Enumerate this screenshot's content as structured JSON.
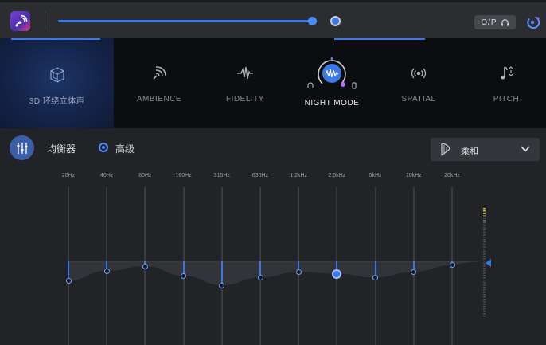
{
  "topbar": {
    "app_icon": "speaker-wave-logo",
    "volume_percent": 100,
    "output_button_label": "O/P",
    "output_icon": "headphones-icon",
    "power_icon": "power-icon"
  },
  "effects": {
    "tabs": [
      {
        "id": "3d",
        "label": "3D 环绕立体声",
        "icon": "cube-icon",
        "selected": true
      },
      {
        "id": "ambience",
        "label": "AMBIENCE",
        "icon": "ambience-icon"
      },
      {
        "id": "fidelity",
        "label": "FIDELITY",
        "icon": "waveform-icon"
      },
      {
        "id": "night",
        "label": "NIGHT MODE",
        "icon": "night-mode-dial-icon",
        "active": true
      },
      {
        "id": "spatial",
        "label": "SPATIAL",
        "icon": "spatial-icon"
      },
      {
        "id": "pitch",
        "label": "PITCH",
        "icon": "pitch-icon"
      }
    ]
  },
  "equalizer": {
    "title": "均衡器",
    "advanced_label": "高级",
    "preset": "柔和",
    "bands": [
      {
        "freq": "20Hz",
        "gain": -2.0
      },
      {
        "freq": "40Hz",
        "gain": -1.0
      },
      {
        "freq": "80Hz",
        "gain": -0.5
      },
      {
        "freq": "160Hz",
        "gain": -1.5
      },
      {
        "freq": "315Hz",
        "gain": -2.5
      },
      {
        "freq": "630Hz",
        "gain": -1.7
      },
      {
        "freq": "1.2kHz",
        "gain": -1.1
      },
      {
        "freq": "2.5kHz",
        "gain": -1.3
      },
      {
        "freq": "5kHz",
        "gain": -1.7
      },
      {
        "freq": "10kHz",
        "gain": -1.1
      },
      {
        "freq": "20kHz",
        "gain": -0.4
      }
    ]
  },
  "colors": {
    "accent": "#3a78e6",
    "background": "#222326",
    "effects_bg": "#0c0d10"
  }
}
